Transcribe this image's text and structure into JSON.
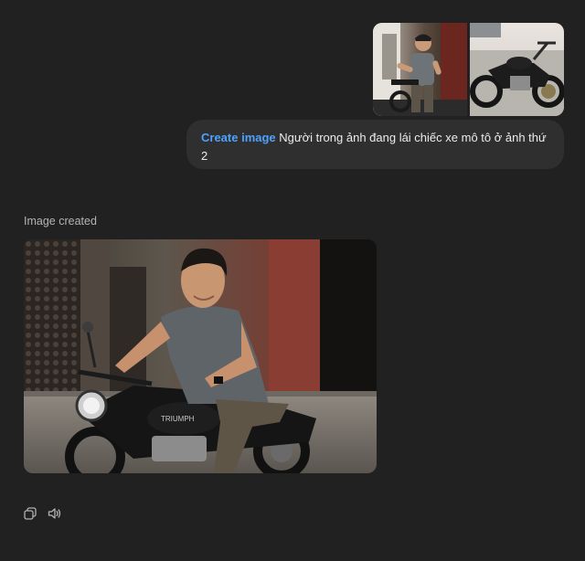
{
  "user_message": {
    "tool_label": "Create image",
    "text": " Người trong ảnh đang lái chiếc xe mô tô ở ảnh thứ 2",
    "attachments": [
      {
        "icon": "person-photo"
      },
      {
        "icon": "motorcycle-photo"
      }
    ]
  },
  "assistant": {
    "status": "Image created",
    "image": {
      "icon": "generated-image-man-on-motorcycle",
      "brand_text": "TRIUMPH"
    }
  },
  "actions": [
    {
      "icon": "copy-icon"
    },
    {
      "icon": "speaker-icon"
    }
  ],
  "colors": {
    "background": "#212121",
    "bubble": "#2f2f2f",
    "accent": "#4ea1ff",
    "muted": "#b4b4b4"
  }
}
